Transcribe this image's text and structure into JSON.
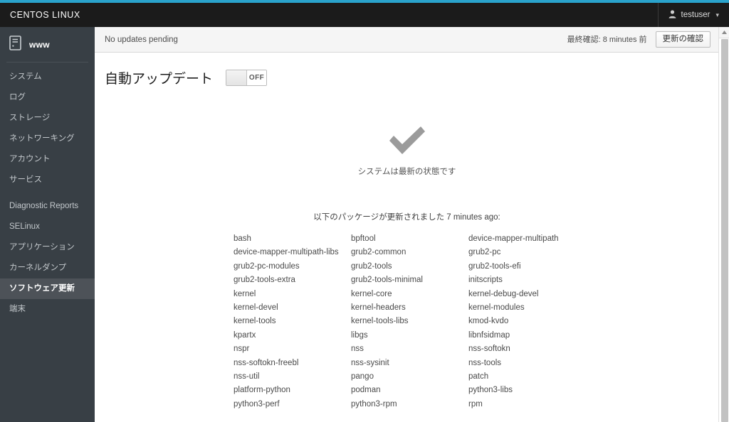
{
  "theme": {
    "accent": "#2aa3cc",
    "header_bg": "#1b1b1b",
    "sidebar_bg": "#383f45",
    "sidebar_active_bg": "#4d5258",
    "toolbar_bg": "#f5f5f5",
    "status_icon_color": "#9b9b9b"
  },
  "header": {
    "brand": "CENTOS LINUX",
    "user_icon": "user-icon",
    "username": "testuser",
    "caret_icon": "chevron-down-icon"
  },
  "sidebar": {
    "host_icon": "server-icon",
    "host_name": "www",
    "groups": [
      {
        "items": [
          {
            "label": "システム"
          },
          {
            "label": "ログ"
          },
          {
            "label": "ストレージ"
          },
          {
            "label": "ネットワーキング"
          },
          {
            "label": "アカウント"
          },
          {
            "label": "サービス"
          }
        ]
      },
      {
        "items": [
          {
            "label": "Diagnostic Reports"
          },
          {
            "label": "SELinux"
          },
          {
            "label": "アプリケーション"
          },
          {
            "label": "カーネルダンプ"
          },
          {
            "label": "ソフトウェア更新",
            "active": true
          },
          {
            "label": "端末"
          }
        ]
      }
    ]
  },
  "toolbar": {
    "status": "No updates pending",
    "last_checked": "最終確認: 8 minutes 前",
    "check_button": "更新の確認"
  },
  "auto_update": {
    "label": "自動アップデート",
    "toggle_state": "OFF"
  },
  "status": {
    "icon": "check-mark-icon",
    "message": "システムは最新の状態です"
  },
  "packages": {
    "heading": "以下のパッケージが更新されました 7 minutes ago:",
    "columns": [
      [
        "bash",
        "device-mapper-multipath-libs",
        "grub2-pc-modules",
        "grub2-tools-extra",
        "kernel",
        "kernel-devel",
        "kernel-tools",
        "kpartx",
        "nspr",
        "nss-softokn-freebl",
        "nss-util",
        "platform-python",
        "python3-perf"
      ],
      [
        "bpftool",
        "grub2-common",
        "grub2-tools",
        "grub2-tools-minimal",
        "kernel-core",
        "kernel-headers",
        "kernel-tools-libs",
        "libgs",
        "nss",
        "nss-sysinit",
        "pango",
        "podman",
        "python3-rpm"
      ],
      [
        "device-mapper-multipath",
        "grub2-pc",
        "grub2-tools-efi",
        "initscripts",
        "kernel-debug-devel",
        "kernel-modules",
        "kmod-kvdo",
        "libnfsidmap",
        "nss-softokn",
        "nss-tools",
        "patch",
        "python3-libs",
        "rpm"
      ]
    ]
  },
  "scrollbar": {
    "up_arrow_icon": "scroll-up-arrow-icon"
  }
}
